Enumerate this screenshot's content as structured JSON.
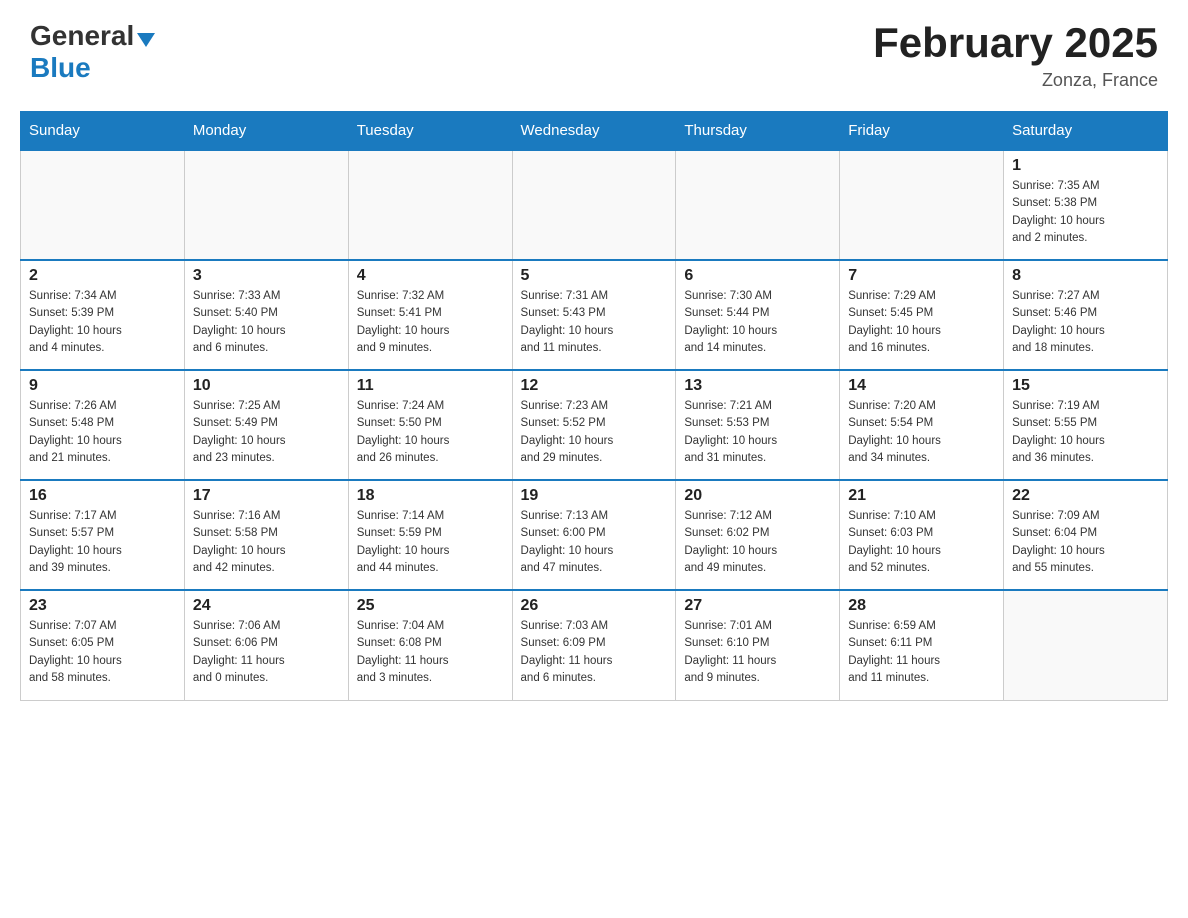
{
  "header": {
    "logo": {
      "general": "General",
      "blue": "Blue",
      "arrow": "▼"
    },
    "title": "February 2025",
    "location": "Zonza, France"
  },
  "weekdays": [
    "Sunday",
    "Monday",
    "Tuesday",
    "Wednesday",
    "Thursday",
    "Friday",
    "Saturday"
  ],
  "weeks": [
    [
      {
        "day": "",
        "info": ""
      },
      {
        "day": "",
        "info": ""
      },
      {
        "day": "",
        "info": ""
      },
      {
        "day": "",
        "info": ""
      },
      {
        "day": "",
        "info": ""
      },
      {
        "day": "",
        "info": ""
      },
      {
        "day": "1",
        "info": "Sunrise: 7:35 AM\nSunset: 5:38 PM\nDaylight: 10 hours\nand 2 minutes."
      }
    ],
    [
      {
        "day": "2",
        "info": "Sunrise: 7:34 AM\nSunset: 5:39 PM\nDaylight: 10 hours\nand 4 minutes."
      },
      {
        "day": "3",
        "info": "Sunrise: 7:33 AM\nSunset: 5:40 PM\nDaylight: 10 hours\nand 6 minutes."
      },
      {
        "day": "4",
        "info": "Sunrise: 7:32 AM\nSunset: 5:41 PM\nDaylight: 10 hours\nand 9 minutes."
      },
      {
        "day": "5",
        "info": "Sunrise: 7:31 AM\nSunset: 5:43 PM\nDaylight: 10 hours\nand 11 minutes."
      },
      {
        "day": "6",
        "info": "Sunrise: 7:30 AM\nSunset: 5:44 PM\nDaylight: 10 hours\nand 14 minutes."
      },
      {
        "day": "7",
        "info": "Sunrise: 7:29 AM\nSunset: 5:45 PM\nDaylight: 10 hours\nand 16 minutes."
      },
      {
        "day": "8",
        "info": "Sunrise: 7:27 AM\nSunset: 5:46 PM\nDaylight: 10 hours\nand 18 minutes."
      }
    ],
    [
      {
        "day": "9",
        "info": "Sunrise: 7:26 AM\nSunset: 5:48 PM\nDaylight: 10 hours\nand 21 minutes."
      },
      {
        "day": "10",
        "info": "Sunrise: 7:25 AM\nSunset: 5:49 PM\nDaylight: 10 hours\nand 23 minutes."
      },
      {
        "day": "11",
        "info": "Sunrise: 7:24 AM\nSunset: 5:50 PM\nDaylight: 10 hours\nand 26 minutes."
      },
      {
        "day": "12",
        "info": "Sunrise: 7:23 AM\nSunset: 5:52 PM\nDaylight: 10 hours\nand 29 minutes."
      },
      {
        "day": "13",
        "info": "Sunrise: 7:21 AM\nSunset: 5:53 PM\nDaylight: 10 hours\nand 31 minutes."
      },
      {
        "day": "14",
        "info": "Sunrise: 7:20 AM\nSunset: 5:54 PM\nDaylight: 10 hours\nand 34 minutes."
      },
      {
        "day": "15",
        "info": "Sunrise: 7:19 AM\nSunset: 5:55 PM\nDaylight: 10 hours\nand 36 minutes."
      }
    ],
    [
      {
        "day": "16",
        "info": "Sunrise: 7:17 AM\nSunset: 5:57 PM\nDaylight: 10 hours\nand 39 minutes."
      },
      {
        "day": "17",
        "info": "Sunrise: 7:16 AM\nSunset: 5:58 PM\nDaylight: 10 hours\nand 42 minutes."
      },
      {
        "day": "18",
        "info": "Sunrise: 7:14 AM\nSunset: 5:59 PM\nDaylight: 10 hours\nand 44 minutes."
      },
      {
        "day": "19",
        "info": "Sunrise: 7:13 AM\nSunset: 6:00 PM\nDaylight: 10 hours\nand 47 minutes."
      },
      {
        "day": "20",
        "info": "Sunrise: 7:12 AM\nSunset: 6:02 PM\nDaylight: 10 hours\nand 49 minutes."
      },
      {
        "day": "21",
        "info": "Sunrise: 7:10 AM\nSunset: 6:03 PM\nDaylight: 10 hours\nand 52 minutes."
      },
      {
        "day": "22",
        "info": "Sunrise: 7:09 AM\nSunset: 6:04 PM\nDaylight: 10 hours\nand 55 minutes."
      }
    ],
    [
      {
        "day": "23",
        "info": "Sunrise: 7:07 AM\nSunset: 6:05 PM\nDaylight: 10 hours\nand 58 minutes."
      },
      {
        "day": "24",
        "info": "Sunrise: 7:06 AM\nSunset: 6:06 PM\nDaylight: 11 hours\nand 0 minutes."
      },
      {
        "day": "25",
        "info": "Sunrise: 7:04 AM\nSunset: 6:08 PM\nDaylight: 11 hours\nand 3 minutes."
      },
      {
        "day": "26",
        "info": "Sunrise: 7:03 AM\nSunset: 6:09 PM\nDaylight: 11 hours\nand 6 minutes."
      },
      {
        "day": "27",
        "info": "Sunrise: 7:01 AM\nSunset: 6:10 PM\nDaylight: 11 hours\nand 9 minutes."
      },
      {
        "day": "28",
        "info": "Sunrise: 6:59 AM\nSunset: 6:11 PM\nDaylight: 11 hours\nand 11 minutes."
      },
      {
        "day": "",
        "info": ""
      }
    ]
  ]
}
